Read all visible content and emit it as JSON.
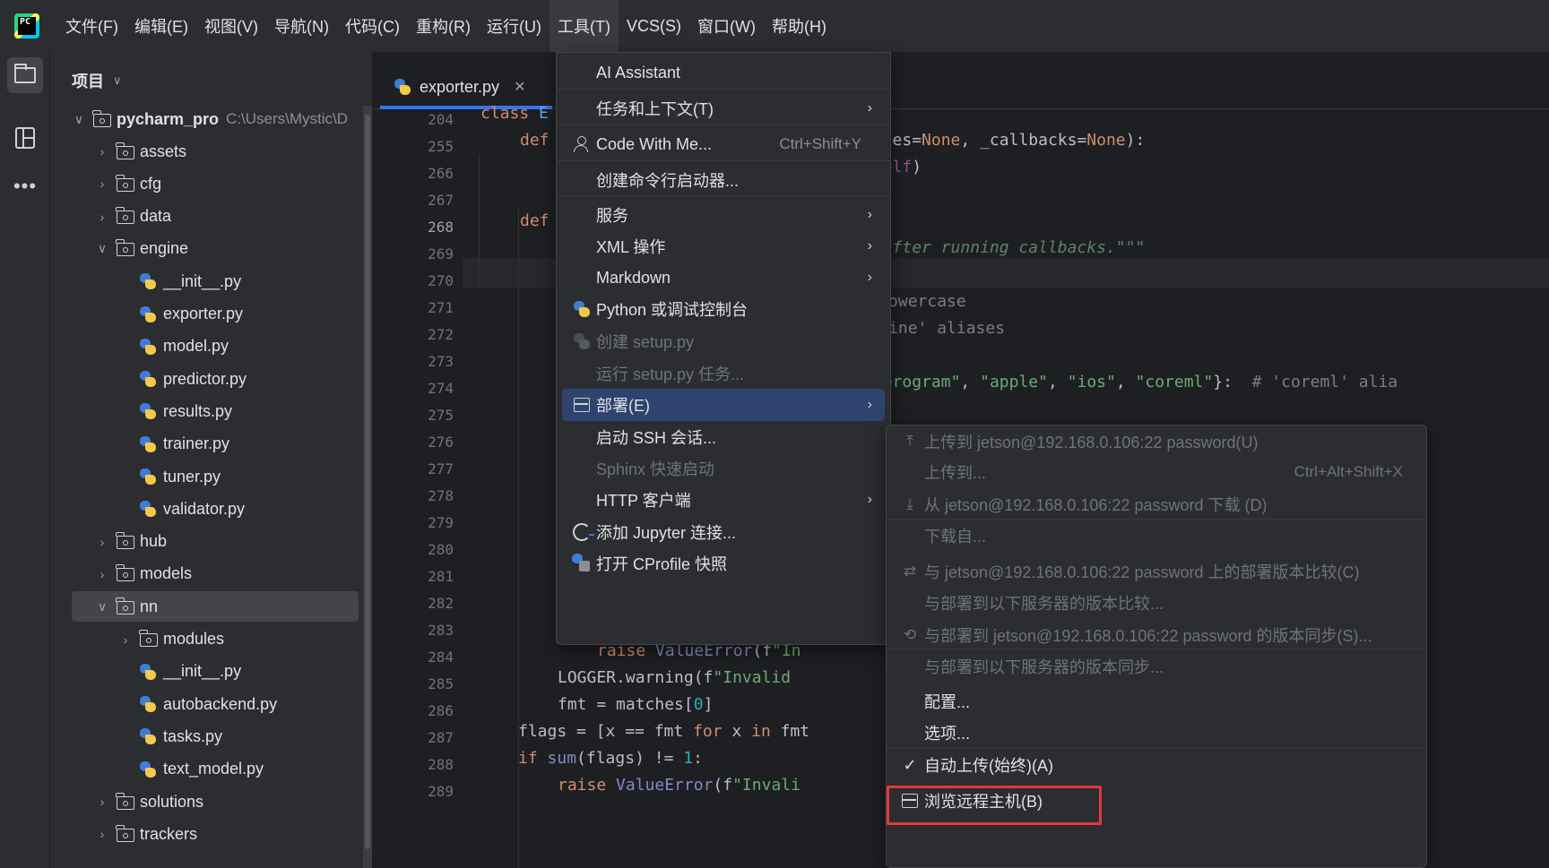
{
  "menubar": {
    "items": [
      "文件(F)",
      "编辑(E)",
      "视图(V)",
      "导航(N)",
      "代码(C)",
      "重构(R)",
      "运行(U)",
      "工具(T)",
      "VCS(S)",
      "窗口(W)",
      "帮助(H)"
    ],
    "active_index": 7
  },
  "project": {
    "header": "项目",
    "root_name": "pycharm_pro",
    "root_path": "C:\\Users\\Mystic\\D",
    "tree": [
      {
        "label": "assets",
        "type": "folder",
        "depth": 1,
        "expanded": false
      },
      {
        "label": "cfg",
        "type": "folder",
        "depth": 1,
        "expanded": false
      },
      {
        "label": "data",
        "type": "folder",
        "depth": 1,
        "expanded": false
      },
      {
        "label": "engine",
        "type": "folder",
        "depth": 1,
        "expanded": true
      },
      {
        "label": "__init__.py",
        "type": "py",
        "depth": 2
      },
      {
        "label": "exporter.py",
        "type": "py",
        "depth": 2
      },
      {
        "label": "model.py",
        "type": "py",
        "depth": 2
      },
      {
        "label": "predictor.py",
        "type": "py",
        "depth": 2
      },
      {
        "label": "results.py",
        "type": "py",
        "depth": 2
      },
      {
        "label": "trainer.py",
        "type": "py",
        "depth": 2
      },
      {
        "label": "tuner.py",
        "type": "py",
        "depth": 2
      },
      {
        "label": "validator.py",
        "type": "py",
        "depth": 2
      },
      {
        "label": "hub",
        "type": "folder",
        "depth": 1,
        "expanded": false
      },
      {
        "label": "models",
        "type": "folder",
        "depth": 1,
        "expanded": false
      },
      {
        "label": "nn",
        "type": "folder",
        "depth": 1,
        "expanded": true,
        "selected": true
      },
      {
        "label": "modules",
        "type": "folder",
        "depth": 2,
        "expanded": false
      },
      {
        "label": "__init__.py",
        "type": "py",
        "depth": 2
      },
      {
        "label": "autobackend.py",
        "type": "py",
        "depth": 2
      },
      {
        "label": "tasks.py",
        "type": "py",
        "depth": 2
      },
      {
        "label": "text_model.py",
        "type": "py",
        "depth": 2
      },
      {
        "label": "solutions",
        "type": "folder",
        "depth": 1,
        "expanded": false
      },
      {
        "label": "trackers",
        "type": "folder",
        "depth": 1,
        "expanded": false
      }
    ]
  },
  "editor": {
    "tab": "exporter.py",
    "line_numbers": [
      "204",
      "255",
      "266",
      "267",
      "268",
      "269",
      "270",
      "271",
      "272",
      "273",
      "274",
      "275",
      "276",
      "277",
      "278",
      "279",
      "280",
      "281",
      "282",
      "283",
      "284",
      "285",
      "286",
      "287",
      "288",
      "289"
    ],
    "current_line": "268"
  },
  "tools_menu": {
    "items": [
      {
        "label": "AI Assistant"
      },
      {
        "label": "任务和上下文(T)",
        "submenu": true
      },
      {
        "label": "Code With Me...",
        "shortcut": "Ctrl+Shift+Y",
        "icon": "user-icon"
      },
      {
        "label": "创建命令行启动器..."
      },
      {
        "label": "服务",
        "submenu": true
      },
      {
        "label": "XML 操作",
        "submenu": true
      },
      {
        "label": "Markdown",
        "submenu": true
      },
      {
        "label": "Python 或调试控制台",
        "icon": "python-console-icon"
      },
      {
        "label": "创建 setup.py",
        "disabled": true,
        "icon": "python-icon"
      },
      {
        "label": "运行 setup.py 任务...",
        "disabled": true
      },
      {
        "label": "部署(E)",
        "submenu": true,
        "highlight": true,
        "icon": "server-icon"
      },
      {
        "label": "启动 SSH 会话..."
      },
      {
        "label": "Sphinx 快速启动",
        "disabled": true
      },
      {
        "label": "HTTP 客户端",
        "submenu": true
      },
      {
        "label": "添加 Jupyter 连接...",
        "icon": "jupyter-icon"
      },
      {
        "label": "打开 CProfile 快照",
        "icon": "profiler-icon"
      }
    ]
  },
  "deploy_menu": {
    "items": [
      {
        "label": "上传到 jetson@192.168.0.106:22 password(U)",
        "disabled": true,
        "icon": "upload-icon"
      },
      {
        "label": "上传到...",
        "disabled": true,
        "shortcut": "Ctrl+Alt+Shift+X"
      },
      {
        "label": "从 jetson@192.168.0.106:22 password 下载 (D)",
        "disabled": true,
        "icon": "download-icon"
      },
      {
        "label": "下载自...",
        "disabled": true
      },
      {
        "label": "与 jetson@192.168.0.106:22 password 上的部署版本比较(C)",
        "disabled": true,
        "icon": "compare-icon"
      },
      {
        "label": "与部署到以下服务器的版本比较...",
        "disabled": true
      },
      {
        "label": "与部署到 jetson@192.168.0.106:22 password 的版本同步(S)...",
        "disabled": true,
        "icon": "sync-icon"
      },
      {
        "label": "与部署到以下服务器的版本同步...",
        "disabled": true
      },
      {
        "label": "配置..."
      },
      {
        "label": "选项..."
      },
      {
        "label": "自动上传(始终)(A)",
        "checked": true
      },
      {
        "label": "浏览远程主机(B)",
        "icon": "server-icon"
      }
    ]
  },
  "colors": {
    "accent": "#3574f0",
    "highlight": "#2e436e",
    "annotation_box": "#e5373d"
  }
}
